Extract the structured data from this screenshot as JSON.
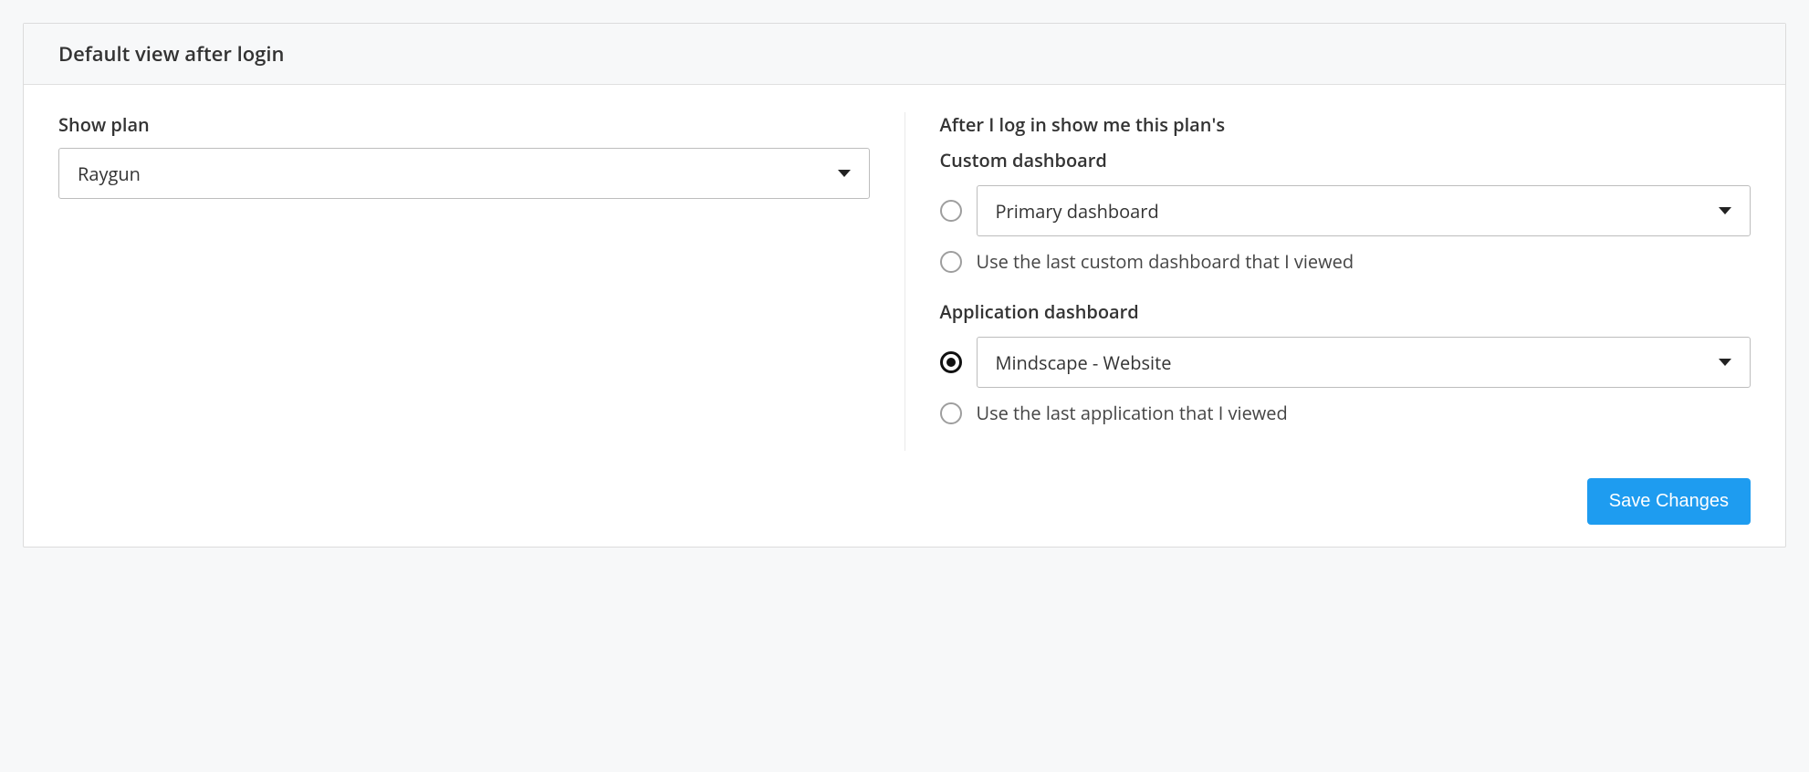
{
  "panel": {
    "title": "Default view after login"
  },
  "left": {
    "label": "Show plan",
    "select_value": "Raygun"
  },
  "right": {
    "heading": "After I log in show me this plan's",
    "custom": {
      "label": "Custom dashboard",
      "select_value": "Primary dashboard",
      "option_last": "Use the last custom dashboard that I viewed"
    },
    "application": {
      "label": "Application dashboard",
      "select_value": "Mindscape - Website",
      "option_last": "Use the last application that I viewed"
    }
  },
  "footer": {
    "save_label": "Save Changes"
  }
}
